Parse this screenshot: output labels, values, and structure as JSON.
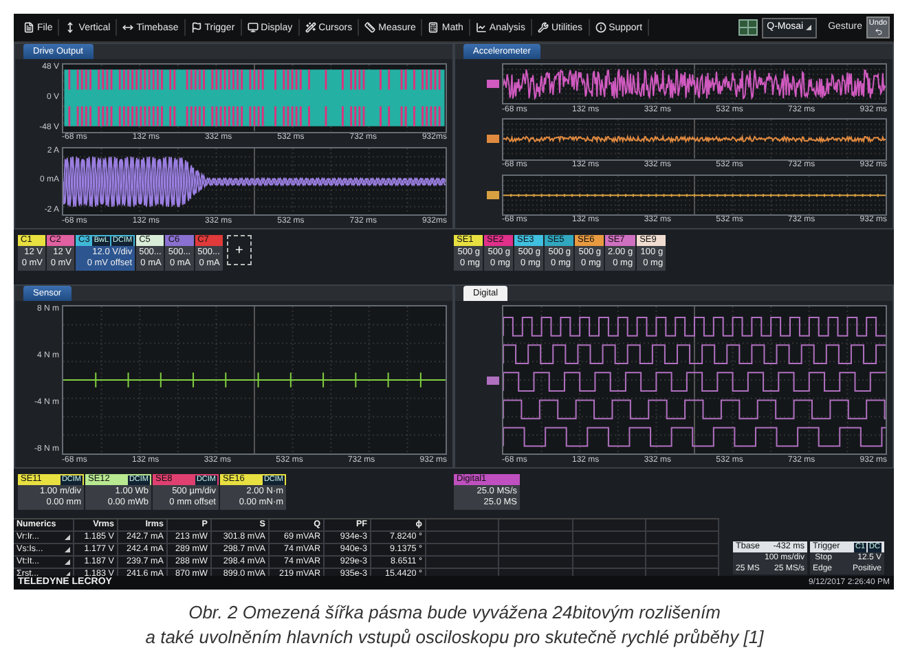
{
  "menu": [
    {
      "label": "File"
    },
    {
      "label": "Vertical"
    },
    {
      "label": "Timebase"
    },
    {
      "label": "Trigger"
    },
    {
      "label": "Display"
    },
    {
      "label": "Cursors"
    },
    {
      "label": "Measure"
    },
    {
      "label": "Math"
    },
    {
      "label": "Analysis"
    },
    {
      "label": "Utilities"
    },
    {
      "label": "Support"
    }
  ],
  "mosaic": "Q-Mosai",
  "gesture": "Gesture",
  "undo": "Undo",
  "top_panes": [
    {
      "title": "Drive Output",
      "selected": false,
      "plots": [
        {
          "kind": "pwm",
          "color": "#e0307a",
          "y_labels": [
            "48 V",
            "0 V",
            "-48 V"
          ],
          "x_labels": [
            "-68 ms",
            "132 ms",
            "332 ms",
            "532 ms",
            "732 ms",
            "932ms"
          ]
        },
        {
          "kind": "decay",
          "color": "#9a7ee0",
          "y_labels": [
            "2 A",
            "0 mA",
            "-2 A"
          ],
          "x_labels": [
            "-68 ms",
            "132 ms",
            "332 ms",
            "532 ms",
            "732 ms",
            "932ms"
          ]
        }
      ]
    },
    {
      "title": "Accelerometer",
      "selected": false,
      "plots": [
        {
          "kind": "noise",
          "color": "#d05ac0",
          "x_labels": [
            "-68 ms",
            "132 ms",
            "332 ms",
            "532 ms",
            "732 ms",
            "932 ms"
          ]
        },
        {
          "kind": "small_noise",
          "color": "#e08a40",
          "x_labels": [
            "-68 ms",
            "132 ms",
            "332 ms",
            "532 ms",
            "732 ms",
            "932 ms"
          ]
        },
        {
          "kind": "flat",
          "color": "#d8a040",
          "x_labels": [
            "-68 ms",
            "132 ms",
            "332 ms",
            "532 ms",
            "732 ms",
            "932 ms"
          ]
        }
      ]
    }
  ],
  "top_channels": [
    {
      "label": "C1",
      "color": "#e8e040",
      "selected": false,
      "lines": [
        "12 V",
        "0 mV"
      ]
    },
    {
      "label": "C2",
      "color": "#e060a0",
      "selected": false,
      "lines": [
        "12 V",
        "0 mV"
      ]
    },
    {
      "label": "C3",
      "color": "#40b8d8",
      "selected": true,
      "tags": [
        "BwL",
        "DCIM"
      ],
      "lines": [
        "12.0 V/div",
        "0 mV offset"
      ]
    },
    {
      "label": "C5",
      "color": "#d8ecd8",
      "selected": false,
      "lines": [
        "500...",
        "0 mA"
      ]
    },
    {
      "label": "C6",
      "color": "#8a70d0",
      "selected": false,
      "lines": [
        "500...",
        "0 mA"
      ]
    },
    {
      "label": "C7",
      "color": "#e03a3a",
      "selected": false,
      "lines": [
        "500...",
        "0 mA"
      ]
    }
  ],
  "add_label": "+",
  "top_sensors": [
    {
      "label": "SE1",
      "color": "#e8e040",
      "selected": false,
      "lines": [
        "500 g",
        "0 mg"
      ]
    },
    {
      "label": "SE2",
      "color": "#e0308a",
      "selected": false,
      "lines": [
        "500 g",
        "0 mg"
      ]
    },
    {
      "label": "SE3",
      "color": "#40c0e0",
      "selected": false,
      "lines": [
        "500 g",
        "0 mg"
      ]
    },
    {
      "label": "SE5",
      "color": "#30a8c0",
      "selected": false,
      "lines": [
        "500 g",
        "0 mg"
      ]
    },
    {
      "label": "SE6",
      "color": "#e89a40",
      "selected": false,
      "lines": [
        "500 g",
        "0 mg"
      ]
    },
    {
      "label": "SE7",
      "color": "#d070c0",
      "selected": false,
      "lines": [
        "2.00 g",
        "0 mg"
      ]
    },
    {
      "label": "SE9",
      "color": "#f0dcd0",
      "selected": false,
      "lines": [
        "100 g",
        "0 mg"
      ]
    }
  ],
  "bottom_panes": [
    {
      "title": "Sensor",
      "selected": false,
      "plots": [
        {
          "kind": "steady",
          "color": "#80d040",
          "y_labels": [
            "8 N m",
            "4 N m",
            "-4 N m",
            "-8 N m"
          ],
          "x_labels": [
            "-68 ms",
            "132 ms",
            "332 ms",
            "532 ms",
            "732 ms",
            "932 ms"
          ]
        }
      ]
    },
    {
      "title": "Digital",
      "selected": true,
      "plots": [
        {
          "kind": "digital",
          "color": "#b070c0",
          "x_labels": [
            "-68 ms",
            "132 ms",
            "332 ms",
            "532 ms",
            "732 ms",
            "932 ms"
          ]
        }
      ]
    }
  ],
  "bottom_channels": [
    {
      "label": "SE11",
      "color": "#e8e040",
      "selected": false,
      "tags": [
        "DCIM"
      ],
      "lines": [
        "1.00 m/div",
        "0.00 mm"
      ]
    },
    {
      "label": "SE12",
      "color": "#b8e890",
      "selected": false,
      "tags": [
        "DCIM"
      ],
      "lines": [
        "1.00 Wb",
        "0.00 mWb"
      ]
    },
    {
      "label": "SE8",
      "color": "#e04070",
      "selected": false,
      "tags": [
        "DCIM"
      ],
      "lines": [
        "500 µm/div",
        "0 mm offset"
      ]
    },
    {
      "label": "SE16",
      "color": "#e8e040",
      "selected": false,
      "tags": [
        "DCIM"
      ],
      "lines": [
        "2.00 N·m",
        "0.00 mN·m"
      ]
    }
  ],
  "bottom_digital": [
    {
      "label": "Digital1",
      "color": "#c050c0",
      "selected": false,
      "lines": [
        "25.0 MS/s",
        "25.0 MS"
      ]
    }
  ],
  "numerics": {
    "columns": [
      "Numerics",
      "Vrms",
      "Irms",
      "P",
      "S",
      "Q",
      "PF",
      "ϕ"
    ],
    "rows": [
      {
        "cells": [
          "Vr:Ir...",
          "1.185 V",
          "242.7 mA",
          "213 mW",
          "301.8 mVA",
          "69 mVAR",
          "934e-3",
          "7.8240 °"
        ]
      },
      {
        "cells": [
          "Vs:Is...",
          "1.177 V",
          "242.4 mA",
          "289 mW",
          "298.7 mVA",
          "74 mVAR",
          "940e-3",
          "9.1375 °"
        ]
      },
      {
        "cells": [
          "Vt:It...",
          "1.187 V",
          "239.7 mA",
          "288 mW",
          "298.4 mVA",
          "74 mVAR",
          "929e-3",
          "8.6511 °"
        ]
      },
      {
        "cells": [
          "Σrst...",
          "1.183 V",
          "241.6 mA",
          "870 mW",
          "899.0 mVA",
          "219 mVAR",
          "935e-3",
          "15.4420 °"
        ]
      }
    ]
  },
  "timebase": {
    "label": "Tbase",
    "value": "-432 ms",
    "scale": "100 ms/div",
    "samples": "25 MS",
    "rate": "25 MS/s"
  },
  "trigger": {
    "label": "Trigger",
    "tags": [
      "C1",
      "DC"
    ],
    "mode": "Stop",
    "level": "12.5 V",
    "type": "Edge",
    "slope": "Positive"
  },
  "footer": {
    "brand": "TELEDYNE LECROY",
    "datetime": "9/12/2017 2:26:40 PM"
  },
  "caption": [
    "Obr. 2  Omezená šířka pásma bude vyvážena 24bitovým rozlišením",
    "a také uvolněním hlavních vstupů osciloskopu pro skutečně rychlé průběhy [1]"
  ]
}
